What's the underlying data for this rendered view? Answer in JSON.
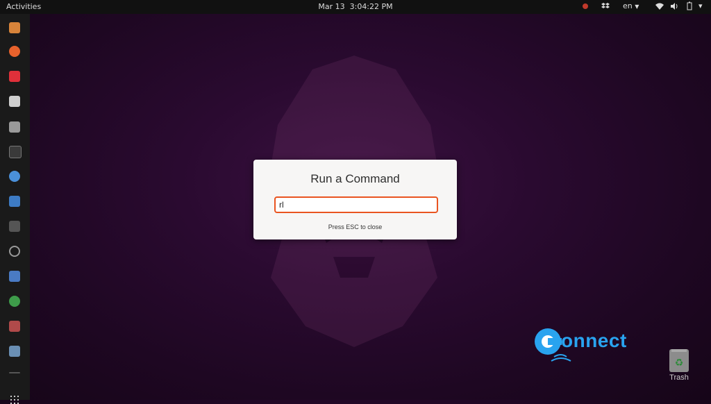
{
  "topbar": {
    "activities": "Activities",
    "date": "Mar 13",
    "time": "3:04:22 PM",
    "language": "en"
  },
  "dialog": {
    "title": "Run a Command",
    "input_value": "rl",
    "hint": "Press ESC to close"
  },
  "watermark": {
    "text": "onnect"
  },
  "desktop": {
    "trash_label": "Trash"
  },
  "colors": {
    "accent": "#e95420",
    "brand_blue": "#29a3ef"
  }
}
